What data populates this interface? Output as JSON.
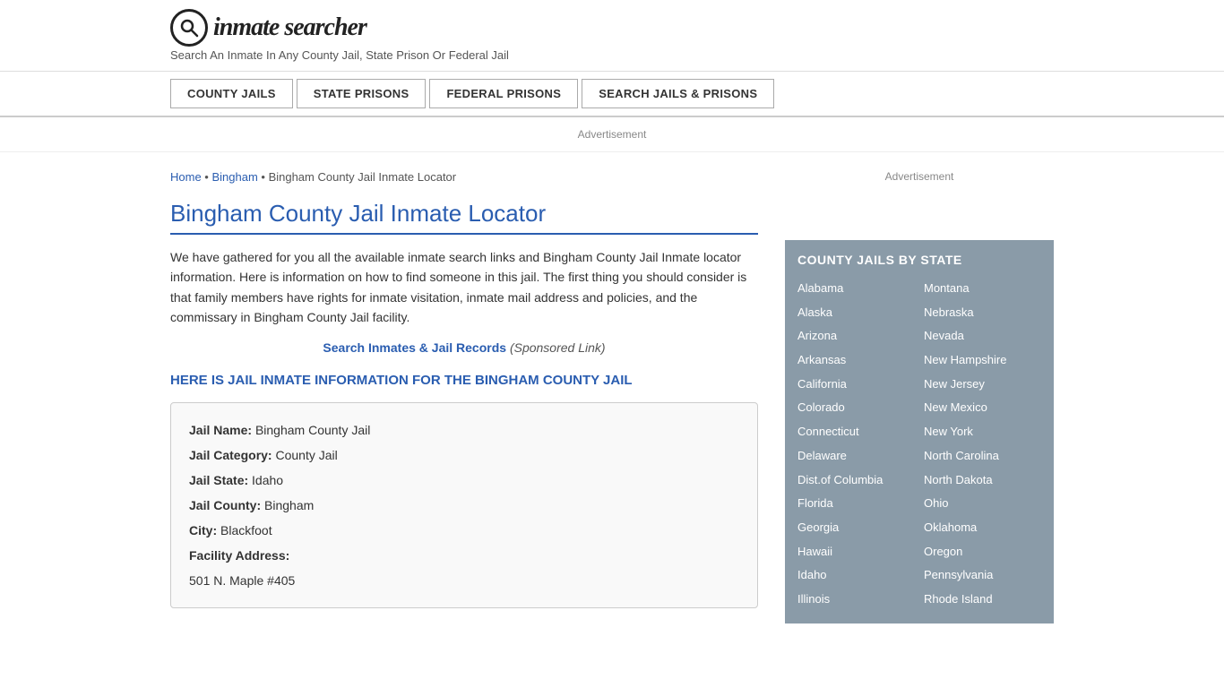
{
  "header": {
    "logo_icon": "🔍",
    "logo_text": "inmate searcher",
    "tagline": "Search An Inmate In Any County Jail, State Prison Or Federal Jail"
  },
  "nav": {
    "buttons": [
      "COUNTY JAILS",
      "STATE PRISONS",
      "FEDERAL PRISONS",
      "SEARCH JAILS & PRISONS"
    ]
  },
  "ad_banner": "Advertisement",
  "breadcrumb": {
    "home": "Home",
    "separator1": " • ",
    "bingham": "Bingham",
    "separator2": " • ",
    "current": "Bingham County Jail Inmate Locator"
  },
  "content": {
    "page_title": "Bingham County Jail Inmate Locator",
    "description": "We have gathered for you all the available inmate search links and Bingham County Jail Inmate locator information. Here is information on how to find someone in this jail. The first thing you should consider is that family members have rights for inmate visitation, inmate mail address and policies, and the commissary in Bingham County Jail facility.",
    "search_link_text": "Search Inmates & Jail Records",
    "search_link_note": "(Sponsored Link)",
    "sub_heading": "HERE IS JAIL INMATE INFORMATION FOR THE BINGHAM COUNTY JAIL",
    "jail_info": {
      "name_label": "Jail Name:",
      "name_value": "Bingham County Jail",
      "category_label": "Jail Category:",
      "category_value": "County Jail",
      "state_label": "Jail State:",
      "state_value": "Idaho",
      "county_label": "Jail County:",
      "county_value": "Bingham",
      "city_label": "City:",
      "city_value": "Blackfoot",
      "address_label": "Facility Address:",
      "address_value": "501 N. Maple #405"
    }
  },
  "sidebar": {
    "ad_label": "Advertisement",
    "county_jails_title": "COUNTY JAILS BY STATE",
    "states_left": [
      "Alabama",
      "Alaska",
      "Arizona",
      "Arkansas",
      "California",
      "Colorado",
      "Connecticut",
      "Delaware",
      "Dist.of Columbia",
      "Florida",
      "Georgia",
      "Hawaii",
      "Idaho",
      "Illinois"
    ],
    "states_right": [
      "Montana",
      "Nebraska",
      "Nevada",
      "New Hampshire",
      "New Jersey",
      "New Mexico",
      "New York",
      "North Carolina",
      "North Dakota",
      "Ohio",
      "Oklahoma",
      "Oregon",
      "Pennsylvania",
      "Rhode Island"
    ]
  }
}
